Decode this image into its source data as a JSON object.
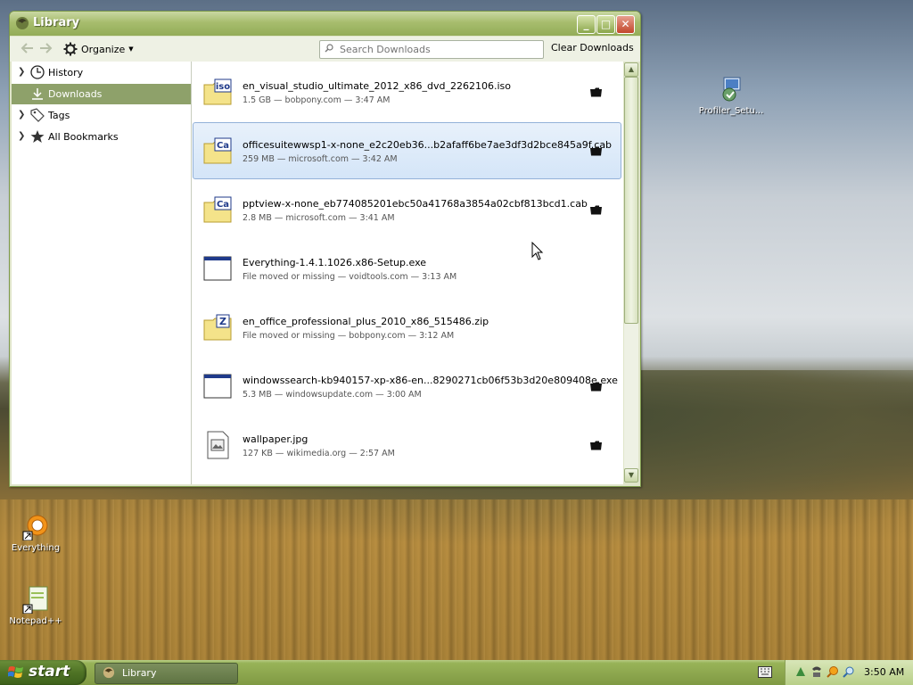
{
  "window": {
    "title": "Library",
    "controls": {
      "minimize": "_",
      "maximize": "□",
      "close": "✕"
    }
  },
  "toolbar": {
    "back_icon": "arrow-left-icon",
    "forward_icon": "arrow-right-icon",
    "organize_label": "Organize",
    "search_placeholder": "Search Downloads",
    "clear_label": "Clear Downloads"
  },
  "sidebar": {
    "items": [
      {
        "label": "History",
        "icon": "clock-icon",
        "expandable": true,
        "selected": false
      },
      {
        "label": "Downloads",
        "icon": "download-icon",
        "expandable": false,
        "selected": true
      },
      {
        "label": "Tags",
        "icon": "tag-icon",
        "expandable": true,
        "selected": false
      },
      {
        "label": "All Bookmarks",
        "icon": "star-icon",
        "expandable": true,
        "selected": false
      }
    ]
  },
  "downloads": [
    {
      "name": "en_visual_studio_ultimate_2012_x86_dvd_2262106.iso",
      "meta": "1.5 GB — bobpony.com — 3:47 AM",
      "icon_text": "iso",
      "open_folder": true
    },
    {
      "name": "officesuitewwsp1-x-none_e2c20eb36...b2afaff6be7ae3df3d2bce845a9f.cab",
      "meta": "259 MB — microsoft.com — 3:42 AM",
      "icon_text": "Ca",
      "open_folder": true,
      "selected": true
    },
    {
      "name": "pptview-x-none_eb774085201ebc50a41768a3854a02cbf813bcd1.cab",
      "meta": "2.8 MB — microsoft.com — 3:41 AM",
      "icon_text": "Ca",
      "open_folder": true
    },
    {
      "name": "Everything-1.4.1.1026.x86-Setup.exe",
      "meta": "File moved or missing — voidtools.com — 3:13 AM",
      "icon_text": "",
      "open_folder": false
    },
    {
      "name": "en_office_professional_plus_2010_x86_515486.zip",
      "meta": "File moved or missing — bobpony.com — 3:12 AM",
      "icon_text": "Z",
      "open_folder": false
    },
    {
      "name": "windowssearch-kb940157-xp-x86-en...8290271cb06f53b3d20e809408e.exe",
      "meta": "5.3 MB — windowsupdate.com — 3:00 AM",
      "icon_text": "",
      "open_folder": true
    },
    {
      "name": "wallpaper.jpg",
      "meta": "127 KB — wikimedia.org — 2:57 AM",
      "icon_text": "",
      "open_folder": true
    }
  ],
  "desktop_icons": [
    {
      "label": "Profiler_Setu..."
    },
    {
      "label": "Everything"
    },
    {
      "label": "Notepad++"
    }
  ],
  "taskbar": {
    "start_label": "start",
    "task_label": "Library",
    "clock": "3:50 AM"
  },
  "colors": {
    "accent": "#8ea16a",
    "titlebar": "#a7bd6d",
    "selection": "#d4e5f8"
  }
}
